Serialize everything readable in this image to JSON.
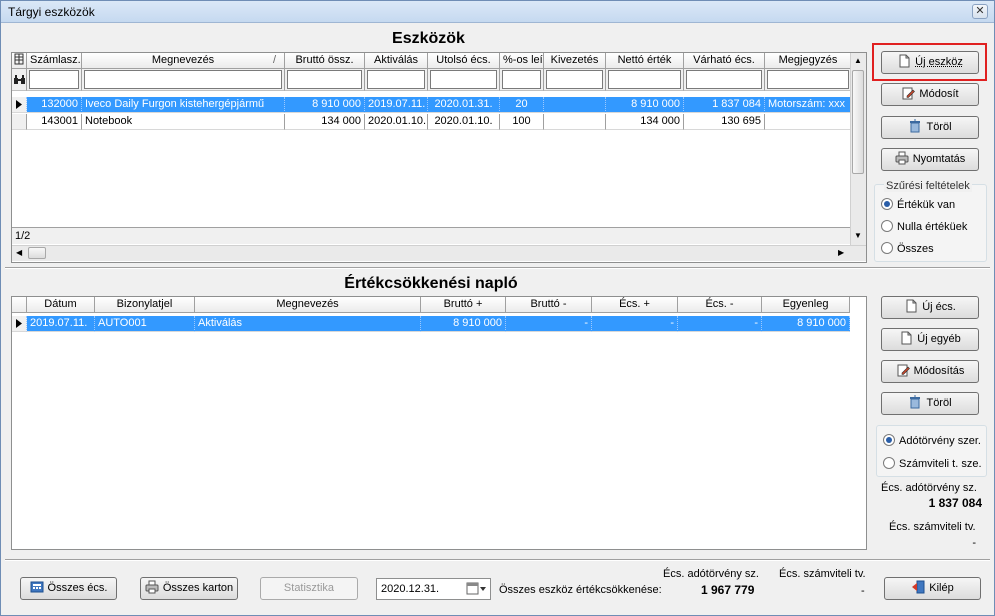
{
  "window": {
    "title": "Tárgyi eszközök",
    "close_glyph": "✕"
  },
  "assets": {
    "title": "Eszközök",
    "columns": [
      "Számlasz.",
      "Megnevezés",
      "Bruttó össz.",
      "Aktiválás",
      "Utolsó écs.",
      "%-os leír.",
      "Kivezetés",
      "Nettó érték",
      "Várható écs.",
      "Megjegyzés"
    ],
    "sort_indicator": "/",
    "rows": [
      {
        "num": "132000",
        "name": "Iveco Daily Furgon kistehergépjármű",
        "gross": "8 910 000",
        "activated": "2019.07.11.",
        "last_dep": "2020.01.31.",
        "pct": "20",
        "retired": "",
        "net": "8 910 000",
        "expected": "1 837 084",
        "note": "Motorszám: xxx"
      },
      {
        "num": "143001",
        "name": "Notebook",
        "gross": "134 000",
        "activated": "2020.01.10.",
        "last_dep": "2020.01.10.",
        "pct": "100",
        "retired": "",
        "net": "134 000",
        "expected": "130 695",
        "note": ""
      }
    ],
    "record_counter": "1/2"
  },
  "asset_buttons": {
    "new": "Új eszköz",
    "modify": "Módosít",
    "delete": "Töröl",
    "print": "Nyomtatás"
  },
  "filter": {
    "legend": "Szűrési feltételek",
    "options": [
      "Értékük van",
      "Nulla értéküek",
      "Összes"
    ],
    "selected": 0
  },
  "log": {
    "title": "Értékcsökkenési napló",
    "columns": [
      "Dátum",
      "Bizonylatjel",
      "Megnevezés",
      "Bruttó +",
      "Bruttó -",
      "Écs. +",
      "Écs. -",
      "Egyenleg"
    ],
    "rows": [
      {
        "date": "2019.07.11.",
        "doc": "AUTO001",
        "name": "Aktiválás",
        "gross_plus": "8 910 000",
        "gross_minus": "-",
        "dep_plus": "-",
        "dep_minus": "-",
        "balance": "8 910 000"
      }
    ]
  },
  "log_buttons": {
    "new_dep": "Új écs.",
    "new_other": "Új egyéb",
    "modify": "Módosítás",
    "delete": "Töröl"
  },
  "mode": {
    "options": [
      "Adótörvény szer.",
      "Számviteli t. sze."
    ],
    "selected": 0
  },
  "summary": {
    "tax_label": "Écs. adótörvény sz.",
    "tax_value": "1 837 084",
    "acc_label": "Écs. számviteli tv.",
    "acc_value": "-"
  },
  "footer": {
    "all_dep": "Összes écs.",
    "all_card": "Összes karton",
    "stats": "Statisztika",
    "date": "2020.12.31.",
    "total_label": "Összes eszköz értékcsökkenése:",
    "tax_label": "Écs. adótörvény sz.",
    "tax_value": "1 967 779",
    "acc_label": "Écs. számviteli tv.",
    "acc_value": "-",
    "exit": "Kilép"
  },
  "colors": {
    "selection": "#3399ff",
    "highlight": "#e02020"
  }
}
